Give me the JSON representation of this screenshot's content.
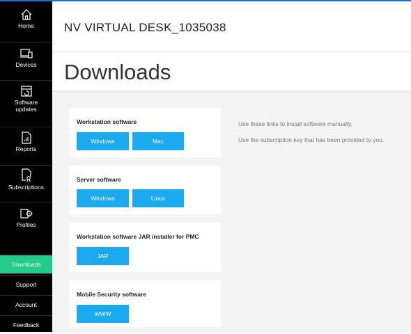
{
  "app": {
    "name": "NV VIRTUAL DESK_1035038"
  },
  "page": {
    "title": "Downloads"
  },
  "sidebar": {
    "items": [
      {
        "label": "Home",
        "icon": "home-icon"
      },
      {
        "label": "Devices",
        "icon": "devices-icon"
      },
      {
        "label": "Software updates",
        "icon": "software-updates-icon"
      },
      {
        "label": "Reports",
        "icon": "reports-icon"
      },
      {
        "label": "Subscriptions",
        "icon": "subscriptions-icon"
      },
      {
        "label": "Profiles",
        "icon": "profiles-icon"
      }
    ],
    "bottom": [
      {
        "label": "Downloads",
        "active": true
      },
      {
        "label": "Support"
      },
      {
        "label": "Account"
      },
      {
        "label": "Feedback"
      }
    ]
  },
  "downloads": [
    {
      "title": "Workstation software",
      "buttons": [
        "Windows",
        "Mac"
      ]
    },
    {
      "title": "Server software",
      "buttons": [
        "Windows",
        "Linux"
      ]
    },
    {
      "title": "Workstation software JAR installer for PMC",
      "buttons": [
        "JAR"
      ]
    },
    {
      "title": "Mobile Security software",
      "buttons": [
        "WWW"
      ]
    }
  ],
  "info": {
    "line1": "Use these links to install software manually.",
    "line2": "Use the subscription key that has been provided to you."
  },
  "colors": {
    "sidebar_bg": "#000000",
    "active_item": "#22cc8b",
    "button": "#1ba9ef",
    "top_accent": "#1f6fd1"
  }
}
